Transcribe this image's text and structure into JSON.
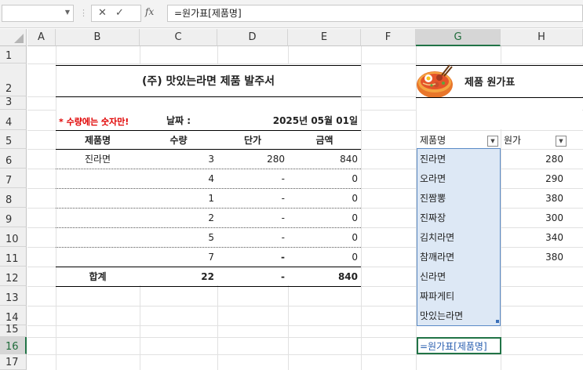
{
  "formula_bar": {
    "name_box": "",
    "cancel_icon": "✕",
    "enter_icon": "✓",
    "fx_label": "fx",
    "formula": "=원가표[제품명]"
  },
  "columns": [
    "A",
    "B",
    "C",
    "D",
    "E",
    "F",
    "G",
    "H"
  ],
  "rows": [
    "1",
    "2",
    "3",
    "4",
    "5",
    "6",
    "7",
    "8",
    "9",
    "10",
    "11",
    "12",
    "13",
    "14",
    "15",
    "16",
    "17"
  ],
  "order_form": {
    "title": "(주) 맛있는라면 제품 발주서",
    "note": "* 수량에는 숫자만!",
    "date_label": "날짜 :",
    "date_value": "2025년 05월 01일",
    "headers": [
      "제품명",
      "수량",
      "단가",
      "금액"
    ],
    "rows": [
      {
        "name": "진라면",
        "qty": "3",
        "price": "280",
        "amount": "840"
      },
      {
        "name": "",
        "qty": "4",
        "price": "-",
        "amount": "0"
      },
      {
        "name": "",
        "qty": "1",
        "price": "-",
        "amount": "0"
      },
      {
        "name": "",
        "qty": "2",
        "price": "-",
        "amount": "0"
      },
      {
        "name": "",
        "qty": "5",
        "price": "-",
        "amount": "0"
      },
      {
        "name": "",
        "qty": "7",
        "price": "-",
        "amount": "0"
      }
    ],
    "total": {
      "label": "합계",
      "qty": "22",
      "price": "-",
      "amount": "840"
    }
  },
  "cost_table": {
    "title": "제품 원가표",
    "header_name": "제품명",
    "header_cost": "원가",
    "dropdown_icon": "▼",
    "rows": [
      {
        "name": "진라면",
        "cost": "280"
      },
      {
        "name": "오라면",
        "cost": "290"
      },
      {
        "name": "진짬뽕",
        "cost": "380"
      },
      {
        "name": "진짜장",
        "cost": "300"
      },
      {
        "name": "김치라면",
        "cost": "340"
      },
      {
        "name": "참깨라면",
        "cost": "380"
      },
      {
        "name": "신라면",
        "cost": ""
      },
      {
        "name": "짜파게티",
        "cost": ""
      },
      {
        "name": "맛있는라면",
        "cost": ""
      }
    ]
  },
  "active_cell": {
    "content": "=원가표[제품명]"
  },
  "colors": {
    "accent": "#217346",
    "selection": "#dde8f5",
    "note_red": "#e00000",
    "formula_blue": "#2a5fb0"
  }
}
